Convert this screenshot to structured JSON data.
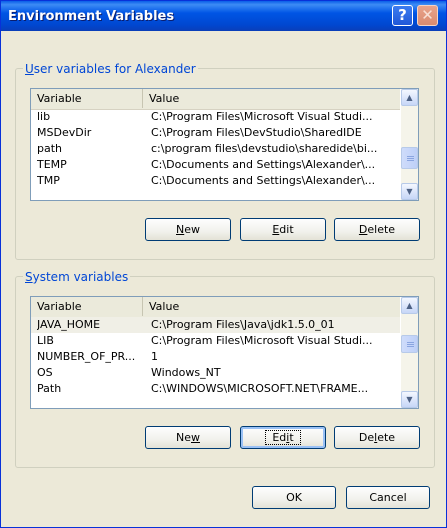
{
  "window": {
    "title": "Environment Variables",
    "help_label": "?",
    "close_label": "✕"
  },
  "user_group": {
    "label_first": "U",
    "label_rest": "ser variables for Alexander",
    "columns": {
      "variable": "Variable",
      "value": "Value"
    },
    "rows": [
      {
        "variable": "lib",
        "value": "C:\\Program Files\\Microsoft Visual Studi..."
      },
      {
        "variable": "MSDevDir",
        "value": "C:\\Program Files\\DevStudio\\SharedIDE"
      },
      {
        "variable": "path",
        "value": "c:\\program files\\devstudio\\sharedide\\bi..."
      },
      {
        "variable": "TEMP",
        "value": "C:\\Documents and Settings\\Alexander\\..."
      },
      {
        "variable": "TMP",
        "value": "C:\\Documents and Settings\\Alexander\\..."
      }
    ],
    "buttons": {
      "new": {
        "u": "N",
        "rest": "ew"
      },
      "edit": {
        "u": "E",
        "rest": "dit"
      },
      "delete": {
        "u": "D",
        "rest": "elete"
      }
    }
  },
  "system_group": {
    "label_first": "S",
    "label_rest": "ystem variables",
    "columns": {
      "variable": "Variable",
      "value": "Value"
    },
    "rows": [
      {
        "variable": "JAVA_HOME",
        "value": "C:\\Program Files\\Java\\jdk1.5.0_01"
      },
      {
        "variable": "LIB",
        "value": "C:\\Program Files\\Microsoft Visual Studi..."
      },
      {
        "variable": "NUMBER_OF_PR...",
        "value": "1"
      },
      {
        "variable": "OS",
        "value": "Windows_NT"
      },
      {
        "variable": "Path",
        "value": "C:\\WINDOWS\\MICROSOFT.NET\\FRAME..."
      }
    ],
    "buttons": {
      "new": {
        "pre": "Ne",
        "u": "w",
        "rest": ""
      },
      "edit": {
        "pre": "Ed",
        "u": "i",
        "rest": "t"
      },
      "delete": {
        "pre": "De",
        "u": "l",
        "rest": "ete"
      }
    }
  },
  "dialog_buttons": {
    "ok": "OK",
    "cancel": "Cancel"
  }
}
